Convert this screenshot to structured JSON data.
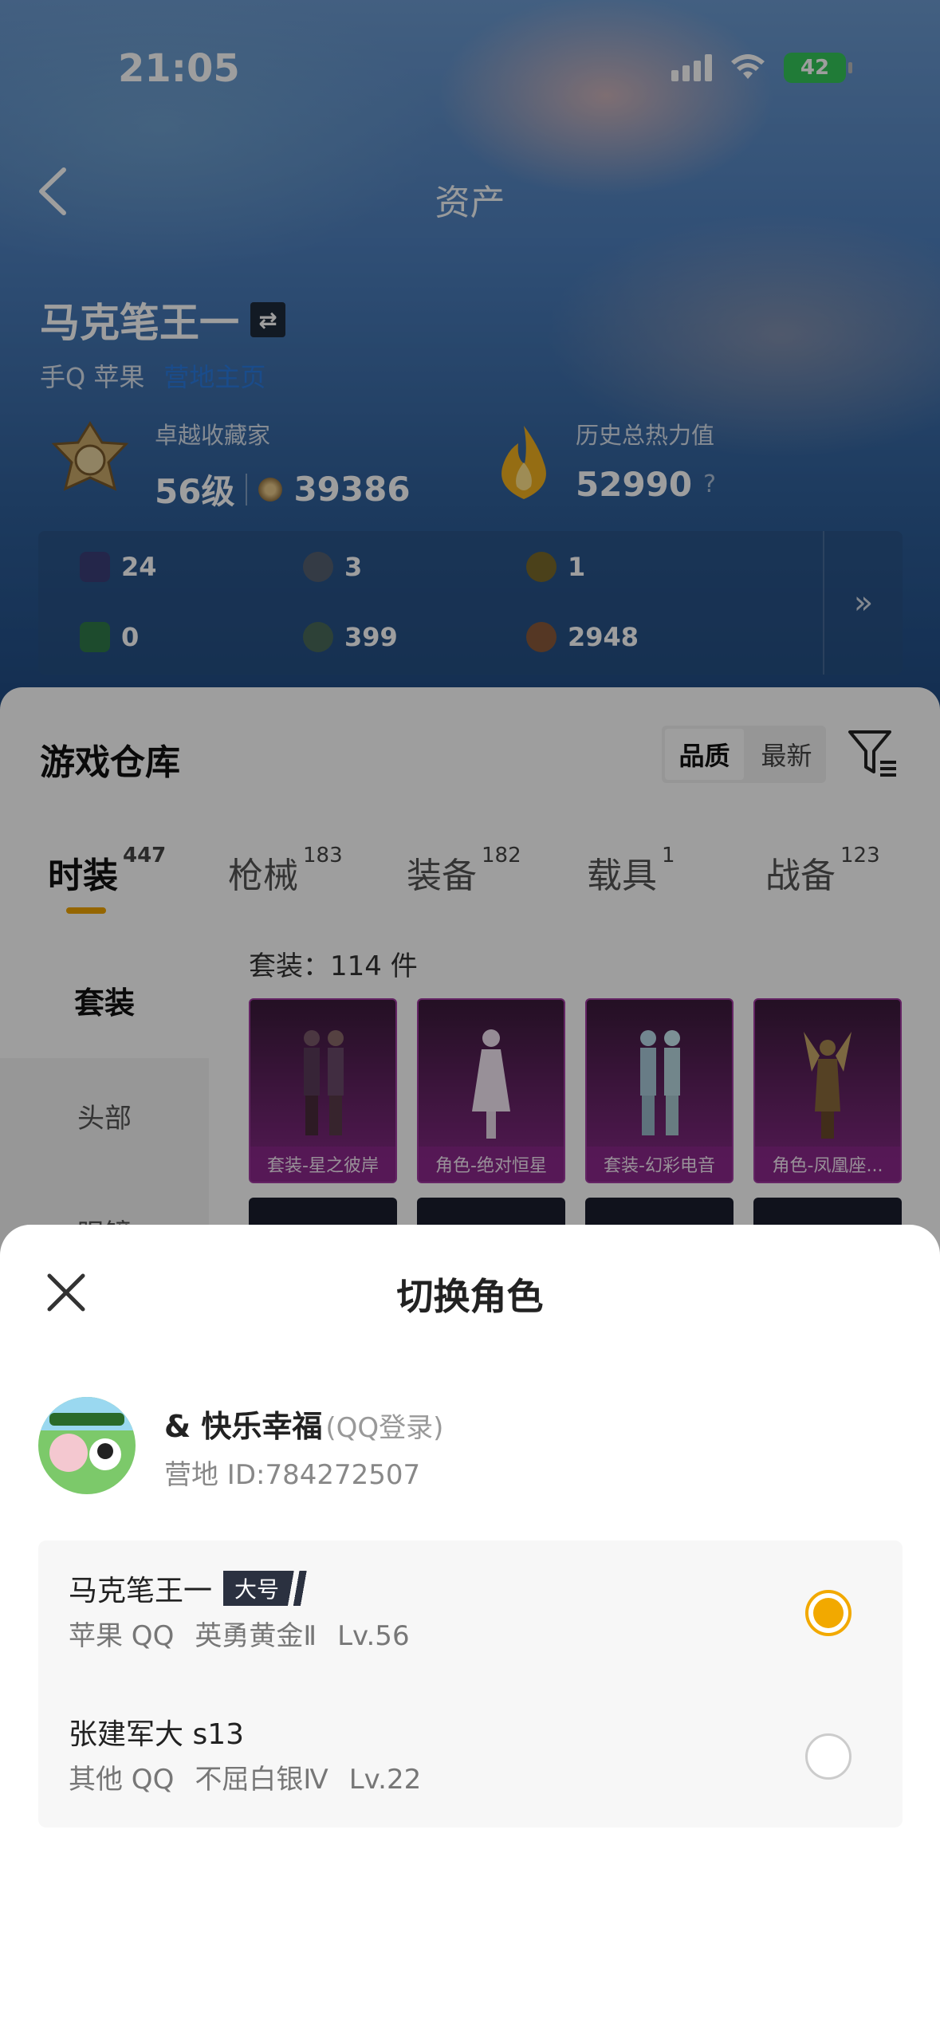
{
  "status_bar": {
    "time": "21:05",
    "battery": "42"
  },
  "nav": {
    "title": "资产"
  },
  "profile": {
    "role_name": "马克笔王一",
    "switch_glyph": "⇄",
    "platform": "手Q 苹果",
    "platform_link": "营地主页",
    "rank_label": "卓越收藏家",
    "level": "56级",
    "collection_score": "39386",
    "heat_label": "历史总热力值",
    "heat_value": "52990",
    "heat_help": "?"
  },
  "resources": {
    "items": [
      {
        "value": "24",
        "icon": "card-icon",
        "color": "#3b3e78"
      },
      {
        "value": "3",
        "icon": "coin-icon",
        "color": "#556070"
      },
      {
        "value": "1",
        "icon": "gold-coin-icon",
        "color": "#7a6a2a"
      },
      {
        "value": "0",
        "icon": "green-card-icon",
        "color": "#2f7a4a"
      },
      {
        "value": "399",
        "icon": "orb-icon",
        "color": "#4a6a5a"
      },
      {
        "value": "2948",
        "icon": "bronze-coin-icon",
        "color": "#8a5a3a"
      }
    ],
    "more": "»"
  },
  "warehouse": {
    "title": "游戏仓库",
    "sort": {
      "quality": "品质",
      "latest": "最新"
    },
    "tabs": [
      {
        "label": "时装",
        "count": "447"
      },
      {
        "label": "枪械",
        "count": "183"
      },
      {
        "label": "装备",
        "count": "182"
      },
      {
        "label": "载具",
        "count": "1"
      },
      {
        "label": "战备",
        "count": "123"
      }
    ],
    "side_items": [
      "套装",
      "头部",
      "眼镜"
    ],
    "suit_count": "套装：114 件",
    "items": [
      {
        "label": "套装-星之彼岸"
      },
      {
        "label": "角色-绝对恒星"
      },
      {
        "label": "套装-幻彩电音"
      },
      {
        "label": "角色-凤凰座..."
      }
    ]
  },
  "sheet": {
    "title": "切换角色",
    "account": {
      "name": "& 快乐幸福",
      "login": "(QQ登录)",
      "id": "营地 ID:784272507"
    },
    "roles": [
      {
        "name": "马克笔王一",
        "tag": "大号",
        "platform": "苹果 QQ",
        "rank": "英勇黄金Ⅱ",
        "level": "Lv.56",
        "selected": true
      },
      {
        "name": "张建军大 s13",
        "tag": "",
        "platform": "其他 QQ",
        "rank": "不屈白银Ⅳ",
        "level": "Lv.22",
        "selected": false
      }
    ]
  },
  "colors": {
    "accent": "#f2a900",
    "tab_underline": "#f0a500",
    "link": "#2a7be0"
  }
}
